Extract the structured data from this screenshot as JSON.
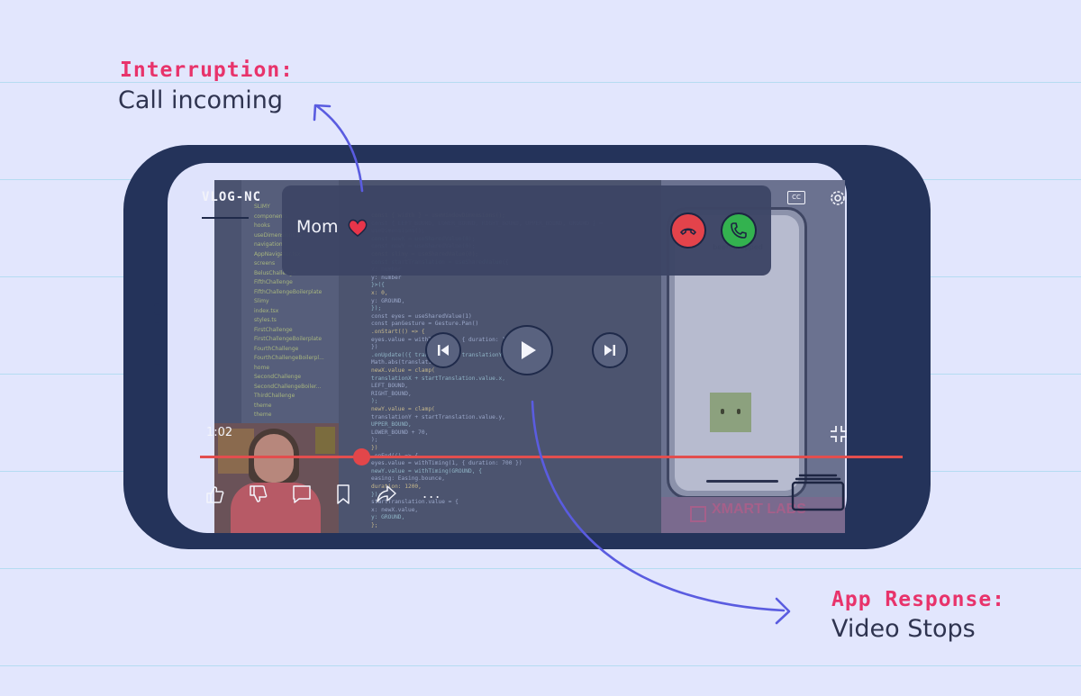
{
  "annotations": {
    "interruption_title": "Interruption:",
    "interruption_text": "Call incoming",
    "response_title": "App Response:",
    "response_text": "Video Stops"
  },
  "player": {
    "channel_name": "VLOG-NC",
    "caller_name": "Mom",
    "timecode": "1:02",
    "cc_label": "CC",
    "more_label": "...",
    "progress_fraction": 0.23
  },
  "icons": {
    "heart": "heart-icon",
    "decline": "decline-call-icon",
    "accept": "accept-call-icon",
    "previous": "skip-previous-icon",
    "play": "play-icon",
    "next": "skip-next-icon",
    "like": "thumbs-up-icon",
    "dislike": "thumbs-down-icon",
    "comment": "comment-icon",
    "save": "bookmark-icon",
    "share": "share-icon",
    "settings": "gear-icon",
    "minimize": "minimize-icon",
    "queue": "queue-icon"
  },
  "colors": {
    "background": "#e2e6fd",
    "accent_pink": "#e8336b",
    "phone_frame": "#24335a",
    "arrow": "#5a5ce0",
    "progress": "#e24e4e",
    "decline": "#e3434b",
    "accept": "#33b24f"
  },
  "video_content": {
    "explorer_items": [
      "SLIMY",
      "components",
      "hooks",
      "useDimensions.ts",
      "navigation",
      "AppNavigator.tsx",
      "screens",
      "BelusChallenge",
      "FifthChallenge",
      "FifthChallengeBoilerplate",
      "Slimy",
      "index.tsx",
      "styles.ts",
      "FirstChallenge",
      "FirstChallengeBoilerplate",
      "FourthChallenge",
      "FourthChallengeBoilerpl...",
      "home",
      "SecondChallenge",
      "SecondChallengeBoiler...",
      "ThirdChallenge",
      "theme",
      "theme"
    ],
    "code_lines": [
      "const { width } = useWindowDimensions();",
      "const { LEFT_BOUND, LOWER_BOUND, RIGHT_BOUND, UPPER_BOUND, GROUND } =",
      "  useDimensions();",
      "const newX = useSharedValue(0);",
      "const newY = useSharedValue(0);",
      "const slimy = useSharedValue(0);",
      "const startTranslation = useSharedValue({",
      "  x: number",
      "  y: number",
      "}>({",
      "  x: 0,",
      "  y: GROUND,",
      "});",
      "const eyes = useSharedValue(1)",
      "const panGesture = Gesture.Pan()",
      "  .onStart(() => {",
      "    eyes.value = withTiming(0, { duration: 100 });",
      "  })",
      "  .onUpdate(({ translationX, translationY }) => {",
      "    Math.abs(translationX)",
      "    newX.value = clamp(",
      "      translationX + startTranslation.value.x,",
      "      LEFT_BOUND,",
      "      RIGHT_BOUND,",
      "    );",
      "    newY.value = clamp(",
      "      translationY + startTranslation.value.y,",
      "      UPPER_BOUND,",
      "      LOWER_BOUND + 70,",
      "    );",
      "  })",
      "  .onEnd(() => {",
      "    eyes.value = withTiming(1, { duration: 700 })",
      "    newY.value = withTiming(GROUND, {",
      "      easing: Easing.bounce,",
      "      duration: 1200,",
      "    });",
      "    startTranslation.value = {",
      "      x: newX.value,",
      "      y: GROUND,",
      "    };"
    ],
    "sim_text": "been dropped",
    "brand_overlay": "XMART LABS"
  }
}
